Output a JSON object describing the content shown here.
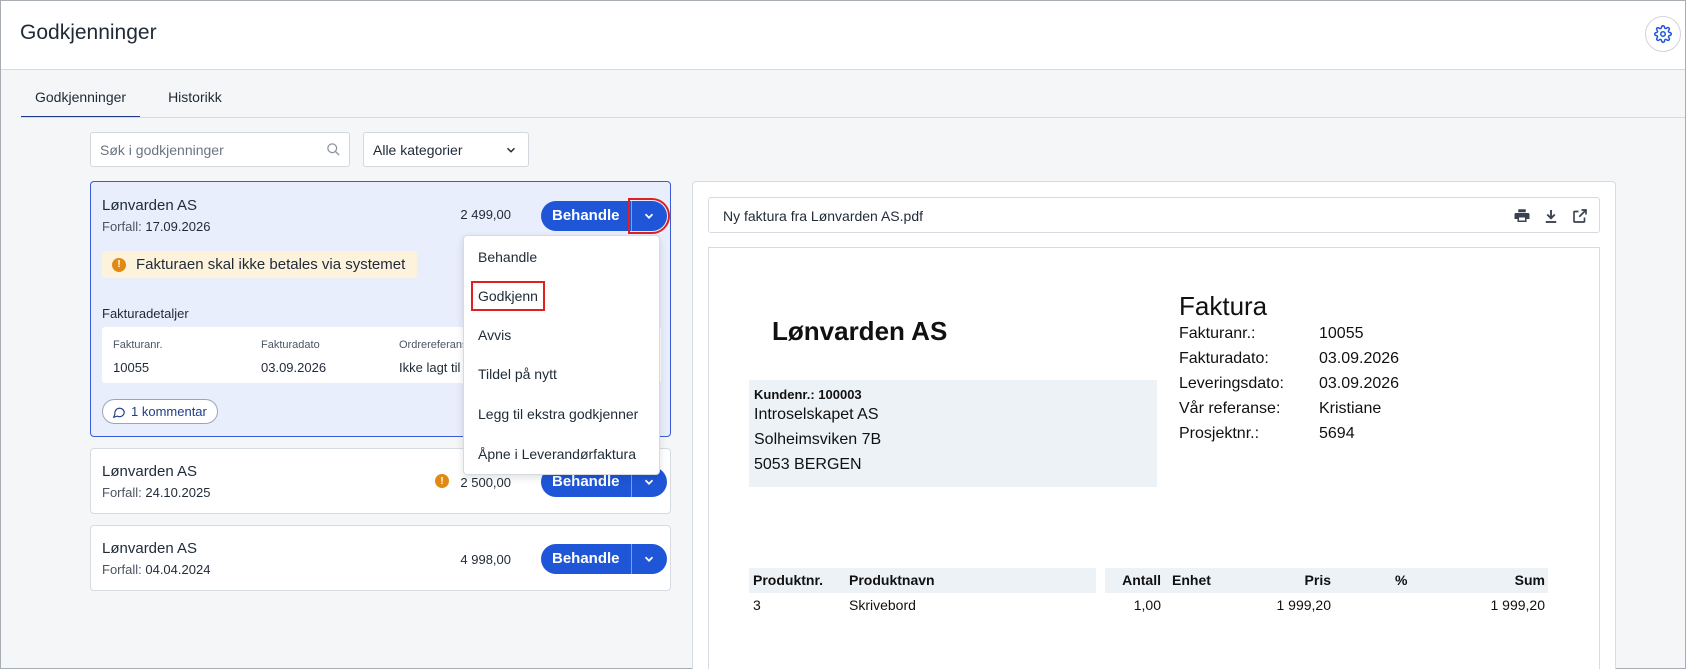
{
  "app": {
    "title": "Godkjenninger"
  },
  "tabs": [
    {
      "label": "Godkjenninger",
      "active": true
    },
    {
      "label": "Historikk",
      "active": false
    }
  ],
  "search": {
    "placeholder": "Søk i godkjenninger",
    "value": ""
  },
  "category": {
    "selected": "Alle kategorier"
  },
  "due_label": "Forfall:",
  "action_label": "Behandle",
  "cards": [
    {
      "vendor": "Lønvarden AS",
      "due": "17.09.2026",
      "amount": "2 499,00",
      "warning": "Fakturaen skal ikke betales via systemet",
      "details_title": "Fakturadetaljer",
      "details": [
        {
          "label": "Fakturanr.",
          "value": "10055"
        },
        {
          "label": "Fakturadato",
          "value": "03.09.2026"
        },
        {
          "label": "Ordrereferanse",
          "value": "Ikke lagt til"
        }
      ],
      "comments": "1 kommentar"
    },
    {
      "vendor": "Lønvarden AS",
      "due": "24.10.2025",
      "amount": "2 500,00"
    },
    {
      "vendor": "Lønvarden AS",
      "due": "04.04.2024",
      "amount": "4 998,00"
    }
  ],
  "dropdown": {
    "items": [
      "Behandle",
      "Godkjenn",
      "Avvis",
      "Tildel på nytt",
      "Legg til ekstra godkjenner",
      "Åpne i Leverandørfaktura"
    ],
    "highlighted": "Godkjenn"
  },
  "viewer": {
    "file_name": "Ny faktura fra Lønvarden AS.pdf",
    "icons": [
      "print-icon",
      "download-icon",
      "open-external-icon"
    ]
  },
  "invoice": {
    "company": "Lønvarden AS",
    "title": "Faktura",
    "meta": [
      {
        "label": "Fakturanr.:",
        "value": "10055"
      },
      {
        "label": "Fakturadato:",
        "value": "03.09.2026"
      },
      {
        "label": "Leveringsdato:",
        "value": "03.09.2026"
      },
      {
        "label": "Vår referanse:",
        "value": "Kristiane"
      },
      {
        "label": "Prosjektnr.:",
        "value": "5694"
      }
    ],
    "customer": {
      "number": "Kundenr.: 100003",
      "lines": [
        "Introselskapet AS",
        "Solheimsviken 7B",
        "5053  BERGEN"
      ]
    },
    "table": {
      "headers": [
        "Produktnr.",
        "Produktnavn",
        "Antall",
        "Enhet",
        "Pris",
        "%",
        "Sum"
      ],
      "rows": [
        [
          "3",
          "Skrivebord",
          "1,00",
          "",
          "1 999,20",
          "",
          "1 999,20"
        ]
      ]
    }
  },
  "colors": {
    "primary": "#1f56d8",
    "selected_bg": "#e8eefc",
    "warning": "#e08a14",
    "highlight": "#e02020"
  }
}
